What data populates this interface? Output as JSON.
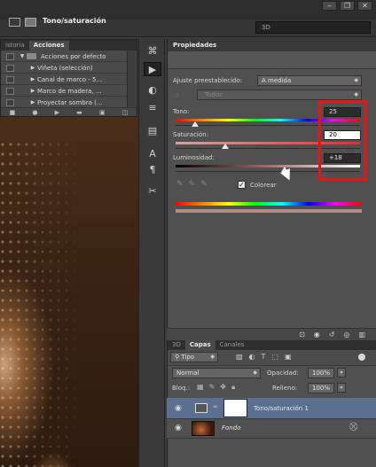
{
  "workspace": {
    "selected": "3D"
  },
  "window_controls": [
    "‒",
    "❐",
    "✕"
  ],
  "actions_panel": {
    "tabs": [
      "istoria",
      "Acciones"
    ],
    "active_tab": "Acciones",
    "items": [
      "Acciones por defecto",
      "Viñeta (selección)",
      "Canal de marco - 5...",
      "Marco de madera, ...",
      "Proyectar sombra (..."
    ]
  },
  "tools": [
    "history-brush-icon",
    "play-icon",
    "adjust-icon",
    "brush-settings-icon",
    "layer-comp-icon",
    "type-icon",
    "paragraph-icon",
    "scissors-icon"
  ],
  "properties": {
    "panel_title": "Propiedades",
    "adjustment_title": "Tono/saturación",
    "preset_label": "Ajuste preestablecido:",
    "preset_value": "A medida",
    "channel_value": "Todos",
    "hue_label": "Tono:",
    "hue_value": "25",
    "saturation_label": "Saturación:",
    "saturation_value": "20",
    "lightness_label": "Luminosidad:",
    "lightness_value": "+18",
    "colorize_label": "Colorear",
    "colorize_checked": true,
    "slider_levels": {
      "hue": 25,
      "saturation": 20,
      "lightness": 18
    }
  },
  "layers": {
    "tabs": [
      "3D",
      "Capas",
      "Canales"
    ],
    "active_tab": "Capas",
    "filter_label": "Tipo",
    "blend_mode": "Normal",
    "opacity_label": "Opacidad:",
    "opacity_value": "100%",
    "lock_label": "Bloq.:",
    "fill_label": "Relleno:",
    "fill_value": "100%",
    "items": [
      {
        "name": "Tono/saturación 1",
        "selected": true
      },
      {
        "name": "Fondo",
        "selected": false
      }
    ]
  },
  "colors": {
    "highlight": "#ee1111",
    "selected_layer": "#5b6f8f"
  }
}
